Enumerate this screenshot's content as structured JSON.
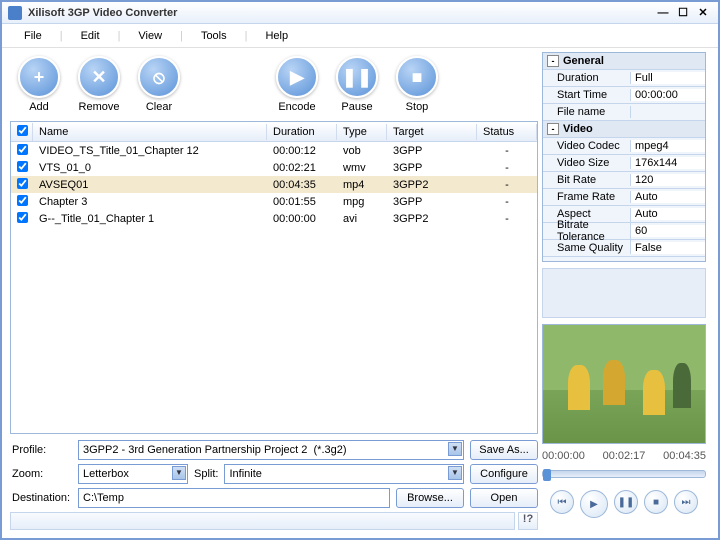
{
  "window": {
    "title": "Xilisoft 3GP Video Converter"
  },
  "menu": {
    "file": "File",
    "edit": "Edit",
    "view": "View",
    "tools": "Tools",
    "help": "Help"
  },
  "toolbar": {
    "add": "Add",
    "remove": "Remove",
    "clear": "Clear",
    "encode": "Encode",
    "pause": "Pause",
    "stop": "Stop"
  },
  "columns": {
    "name": "Name",
    "duration": "Duration",
    "type": "Type",
    "target": "Target",
    "status": "Status"
  },
  "rows": [
    {
      "name": "VIDEO_TS_Title_01_Chapter 12",
      "duration": "00:00:12",
      "type": "vob",
      "target": "3GPP",
      "status": "-"
    },
    {
      "name": "VTS_01_0",
      "duration": "00:02:21",
      "type": "wmv",
      "target": "3GPP",
      "status": "-"
    },
    {
      "name": "AVSEQ01",
      "duration": "00:04:35",
      "type": "mp4",
      "target": "3GPP2",
      "status": "-",
      "selected": true
    },
    {
      "name": "Chapter 3",
      "duration": "00:01:55",
      "type": "mpg",
      "target": "3GPP",
      "status": "-"
    },
    {
      "name": "G--_Title_01_Chapter 1",
      "duration": "00:00:00",
      "type": "avi",
      "target": "3GPP2",
      "status": "-"
    }
  ],
  "form": {
    "profile_label": "Profile:",
    "profile_value": "3GPP2 - 3rd Generation Partnership Project 2  (*.3g2)",
    "zoom_label": "Zoom:",
    "zoom_value": "Letterbox",
    "split_label": "Split:",
    "split_value": "Infinite",
    "dest_label": "Destination:",
    "dest_value": "C:\\Temp",
    "save_as": "Save As...",
    "configure": "Configure",
    "browse": "Browse...",
    "open": "Open"
  },
  "properties": {
    "general_label": "General",
    "video_label": "Video",
    "items": [
      {
        "cat": "general"
      },
      {
        "k": "Duration",
        "v": "Full"
      },
      {
        "k": "Start Time",
        "v": "00:00:00"
      },
      {
        "k": "File name",
        "v": ""
      },
      {
        "cat": "video"
      },
      {
        "k": "Video Codec",
        "v": "mpeg4"
      },
      {
        "k": "Video Size",
        "v": "176x144"
      },
      {
        "k": "Bit Rate",
        "v": "120"
      },
      {
        "k": "Frame Rate",
        "v": "Auto"
      },
      {
        "k": "Aspect",
        "v": "Auto"
      },
      {
        "k": "Bitrate Tolerance",
        "v": "60"
      },
      {
        "k": "Same Quality",
        "v": "False"
      }
    ]
  },
  "timeline": {
    "t0": "00:00:00",
    "t1": "00:02:17",
    "t2": "00:04:35"
  },
  "help_icon": "!?"
}
